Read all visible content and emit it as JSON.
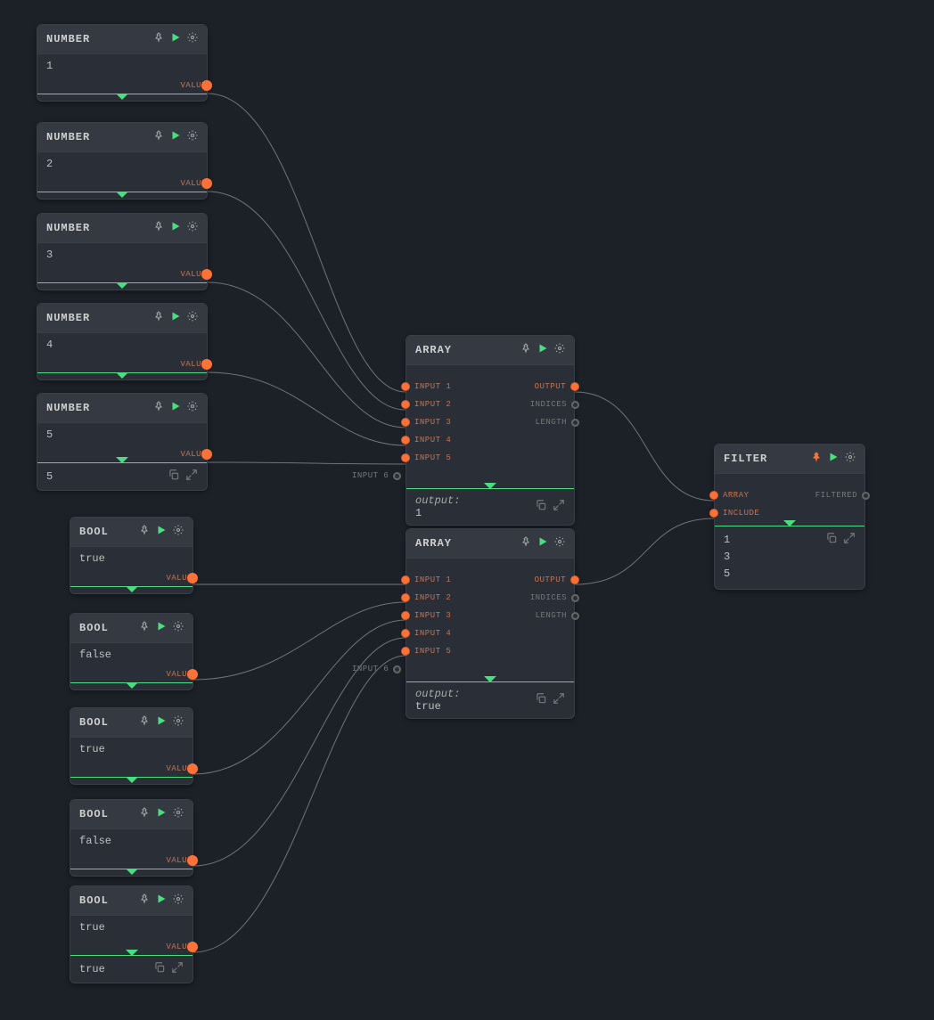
{
  "labels": {
    "number": "NUMBER",
    "bool": "BOOL",
    "array": "ARRAY",
    "filter": "FILTER",
    "value": "VALUE",
    "output": "OUTPUT",
    "indices": "INDICES",
    "length": "LENGTH",
    "input_prefix": "INPUT",
    "array_port": "ARRAY",
    "include": "INCLUDE",
    "filtered": "FILTERED",
    "output_label": "output:"
  },
  "numbers": [
    {
      "value": "1"
    },
    {
      "value": "2"
    },
    {
      "value": "3"
    },
    {
      "value": "4"
    },
    {
      "value": "5"
    }
  ],
  "number_footer": "5",
  "bools": [
    {
      "value": "true"
    },
    {
      "value": "false"
    },
    {
      "value": "true"
    },
    {
      "value": "false"
    },
    {
      "value": "true"
    }
  ],
  "bool_footer": "true",
  "array1": {
    "inputs": [
      "INPUT 1",
      "INPUT 2",
      "INPUT 3",
      "INPUT 4",
      "INPUT 5",
      "INPUT 6"
    ],
    "output_preview": "1"
  },
  "array2": {
    "inputs": [
      "INPUT 1",
      "INPUT 2",
      "INPUT 3",
      "INPUT 4",
      "INPUT 5",
      "INPUT 6"
    ],
    "output_preview": "true"
  },
  "filter": {
    "results": [
      "1",
      "3",
      "5"
    ]
  }
}
